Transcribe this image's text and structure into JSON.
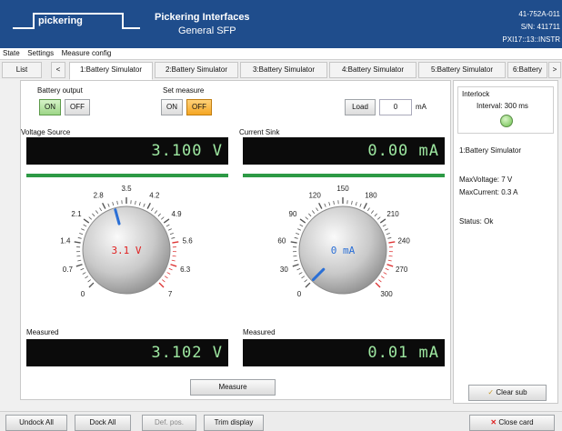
{
  "header": {
    "logo_text": "pickering",
    "brand": "Pickering Interfaces",
    "product": "General SFP",
    "right_line1": "41-752A-011",
    "right_line2": "S/N: 411711",
    "right_line3": "PXI17::13::INSTR"
  },
  "menu": {
    "items": [
      "State",
      "Settings",
      "Measure config"
    ]
  },
  "tabs": {
    "list": "List",
    "left_arrow": "<",
    "right_arrow": ">",
    "items": [
      "1:Battery Simulator",
      "2:Battery Simulator",
      "3:Battery Simulator",
      "4:Battery Simulator",
      "5:Battery Simulator",
      "6:Battery"
    ]
  },
  "controls": {
    "battery_output_label": "Battery output",
    "on": "ON",
    "off": "OFF",
    "set_measure_label": "Set measure",
    "load_label": "Load",
    "load_value": "0",
    "load_unit": "mA"
  },
  "voltage": {
    "title": "Voltage Source",
    "display": "3.100 V",
    "dial_value": "3.1 V",
    "dial_fraction": 0.443,
    "ticks": [
      "0",
      "0.7",
      "1.4",
      "2.1",
      "2.8",
      "3.5",
      "4.2",
      "4.9",
      "5.6",
      "6.3",
      "7"
    ],
    "measured_label": "Measured",
    "measured": "3.102 V"
  },
  "current": {
    "title": "Current Sink",
    "display": "0.00 mA",
    "dial_value": "0 mA",
    "dial_fraction": 0,
    "ticks": [
      "0",
      "30",
      "60",
      "90",
      "120",
      "150",
      "180",
      "210",
      "240",
      "270",
      "300"
    ],
    "measured_label": "Measured",
    "measured": "0.01 mA"
  },
  "measure_button": "Measure",
  "side": {
    "interlock_label": "Interlock",
    "interval": "Interval: 300 ms",
    "card_name": "1:Battery Simulator",
    "max_voltage": "MaxVoltage: 7 V",
    "max_current": "MaxCurrent: 0.3 A",
    "status": "Status: Ok",
    "clear_sub": "Clear sub"
  },
  "bottom": {
    "undock_all": "Undock All",
    "dock_all": "Dock All",
    "def_pos": "Def. pos.",
    "trim_display": "Trim display",
    "close_card": "Close card"
  },
  "colors": {
    "header_bg": "#1f4d8c",
    "lcd_text": "#9ee8a1",
    "on_green": "#9dd687",
    "off_orange": "#f5a623",
    "voltage_value": "#e02020",
    "current_value": "#2a6fd6"
  }
}
